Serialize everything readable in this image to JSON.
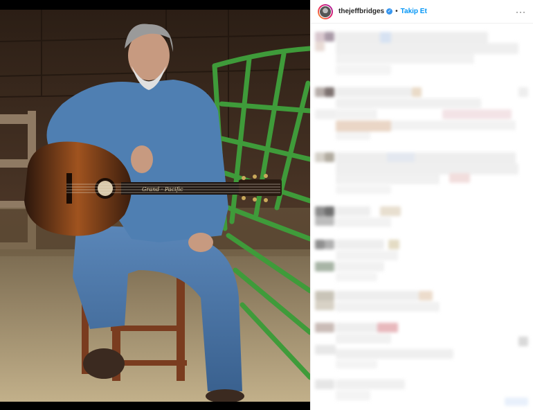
{
  "post": {
    "username": "thejeffbridges",
    "verified_mark": "✓",
    "separator": "•",
    "follow_label": "Takip Et",
    "more_label": "···"
  },
  "colors": {
    "follow": "#0095f6",
    "verified": "#3897f0",
    "bench_green": "#3f9b3a"
  },
  "icons": [
    "verified-icon",
    "more-options-icon"
  ]
}
